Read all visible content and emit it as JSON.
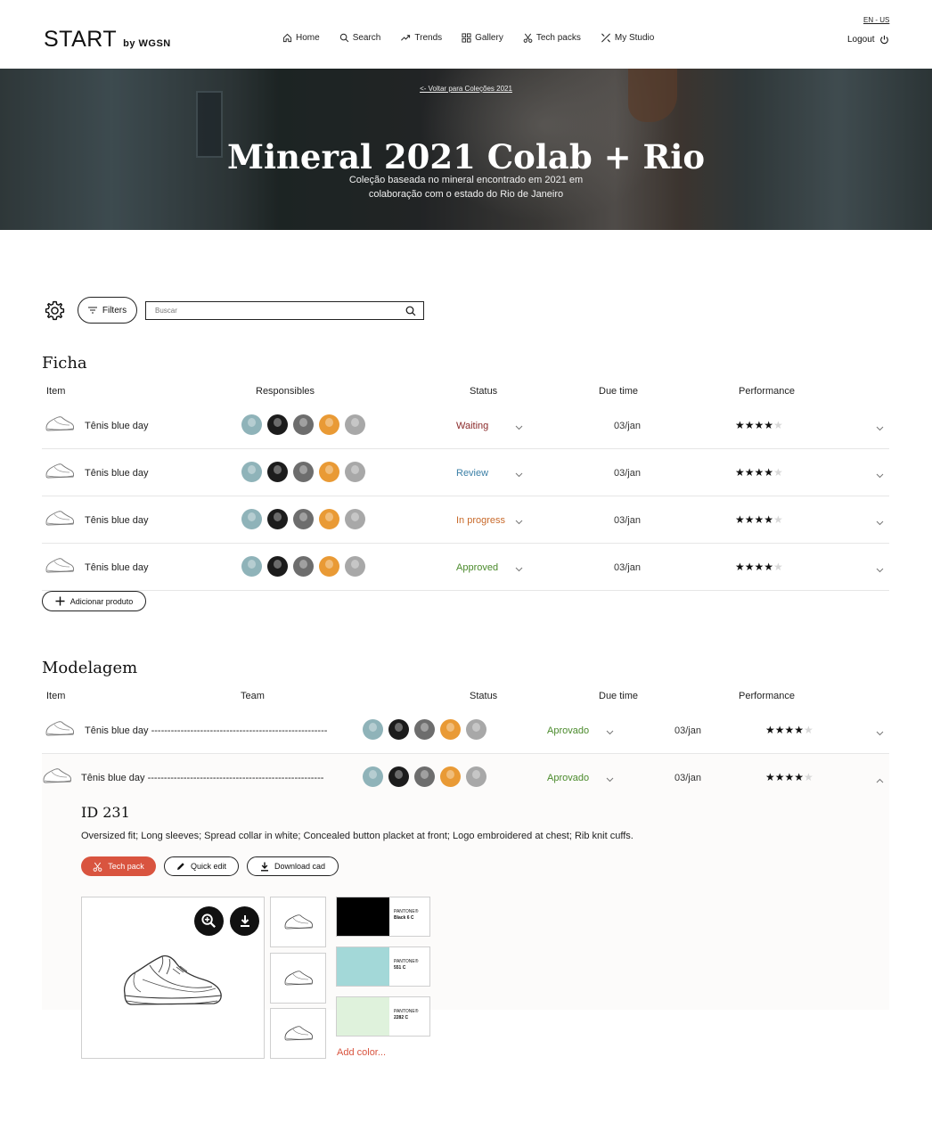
{
  "brand": {
    "name": "START",
    "by": "by WGSN"
  },
  "nav": [
    {
      "label": "Home",
      "icon": "home-icon"
    },
    {
      "label": "Search",
      "icon": "search-icon"
    },
    {
      "label": "Trends",
      "icon": "trend-icon"
    },
    {
      "label": "Gallery",
      "icon": "gallery-icon"
    },
    {
      "label": "Tech packs",
      "icon": "scissors-icon"
    },
    {
      "label": "My Studio",
      "icon": "studio-icon"
    }
  ],
  "language": "EN - US",
  "logout": "Logout",
  "hero": {
    "back_link": "<- Voltar para Coleções 2021",
    "title": "Mineral 2021 Colab + Rio",
    "subtitle": "Coleção baseada no mineral encontrado em 2021 em colaboração com o estado do Rio de Janeiro"
  },
  "toolbar": {
    "filters": "Filters",
    "search_placeholder": "Buscar"
  },
  "ficha": {
    "title": "Ficha",
    "headers": {
      "item": "Item",
      "responsibles": "Responsibles",
      "status": "Status",
      "due": "Due time",
      "performance": "Performance"
    },
    "rows": [
      {
        "name": "Tênis blue day",
        "status": "Waiting",
        "status_color": "#8b2a2a",
        "due": "03/jan",
        "rating": 4
      },
      {
        "name": "Tênis blue day",
        "status": "Review",
        "status_color": "#3b7fa6",
        "due": "03/jan",
        "rating": 4
      },
      {
        "name": "Tênis blue day",
        "status": "In progress",
        "status_color": "#c86a2b",
        "due": "03/jan",
        "rating": 4
      },
      {
        "name": "Tênis blue day",
        "status": "Approved",
        "status_color": "#4a8a2b",
        "due": "03/jan",
        "rating": 4
      }
    ],
    "add_button": "Adicionar produto"
  },
  "modelagem": {
    "title": "Modelagem",
    "headers": {
      "item": "Item",
      "team": "Team",
      "status": "Status",
      "due": "Due time",
      "performance": "Performance"
    },
    "rows": [
      {
        "name": "Tênis blue day ------------------------------------------------------",
        "status": "Aprovado",
        "status_color": "#4a8a2b",
        "due": "03/jan",
        "rating": 4
      },
      {
        "name": "Tênis blue day ------------------------------------------------------",
        "status": "Aprovado",
        "status_color": "#4a8a2b",
        "due": "03/jan",
        "rating": 4
      }
    ],
    "detail": {
      "id": "ID 231",
      "description": "Oversized fit; Long sleeves; Spread collar in white; Concealed button placket at front; Logo embroidered at chest; Rib knit cuffs.",
      "tech_pack": "Tech pack",
      "quick_edit": "Quick edit",
      "download_cad": "Download cad",
      "swatches": [
        {
          "brand": "PANTONE®",
          "code": "Black 6 C",
          "color": "#000000"
        },
        {
          "brand": "PANTONE®",
          "code": "551 C",
          "color": "#a3d8d8"
        },
        {
          "brand": "PANTONE®",
          "code": "2282 C",
          "color": "#dff2dc"
        }
      ],
      "add_color": "Add color..."
    }
  }
}
